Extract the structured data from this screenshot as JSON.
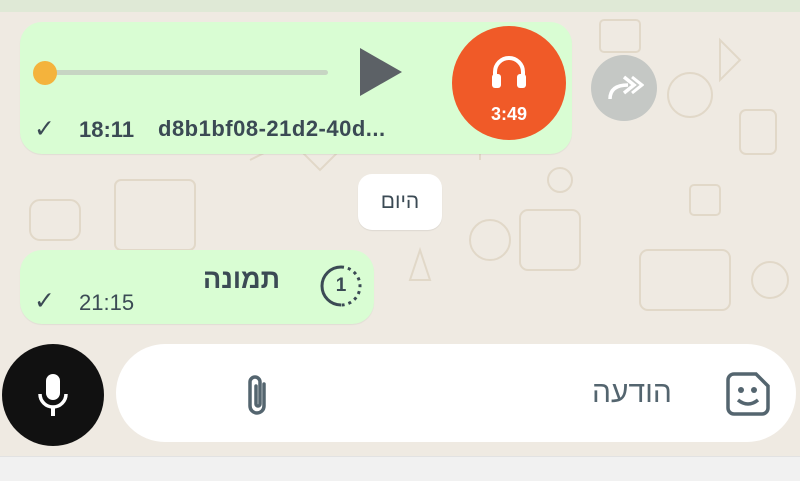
{
  "audio_message": {
    "duration": "3:49",
    "time": "18:11",
    "filename": "d8b1bf08-21d2-40d...",
    "progress": 0.0,
    "status_icon": "single-check-icon",
    "avatar_icon": "headphones-icon",
    "avatar_color": "#f05a28"
  },
  "date_separator": "היום",
  "image_message": {
    "label": "תמונה",
    "time": "21:15",
    "view_once_count": "1",
    "status_icon": "single-check-icon"
  },
  "composer": {
    "placeholder": "הודעה",
    "attach_icon": "paperclip-icon",
    "sticker_icon": "sticker-icon",
    "mic_icon": "microphone-icon"
  },
  "colors": {
    "chat_background": "#efeae2",
    "bubble_outgoing": "#d9fdd3",
    "accent_orange": "#f05a28"
  }
}
